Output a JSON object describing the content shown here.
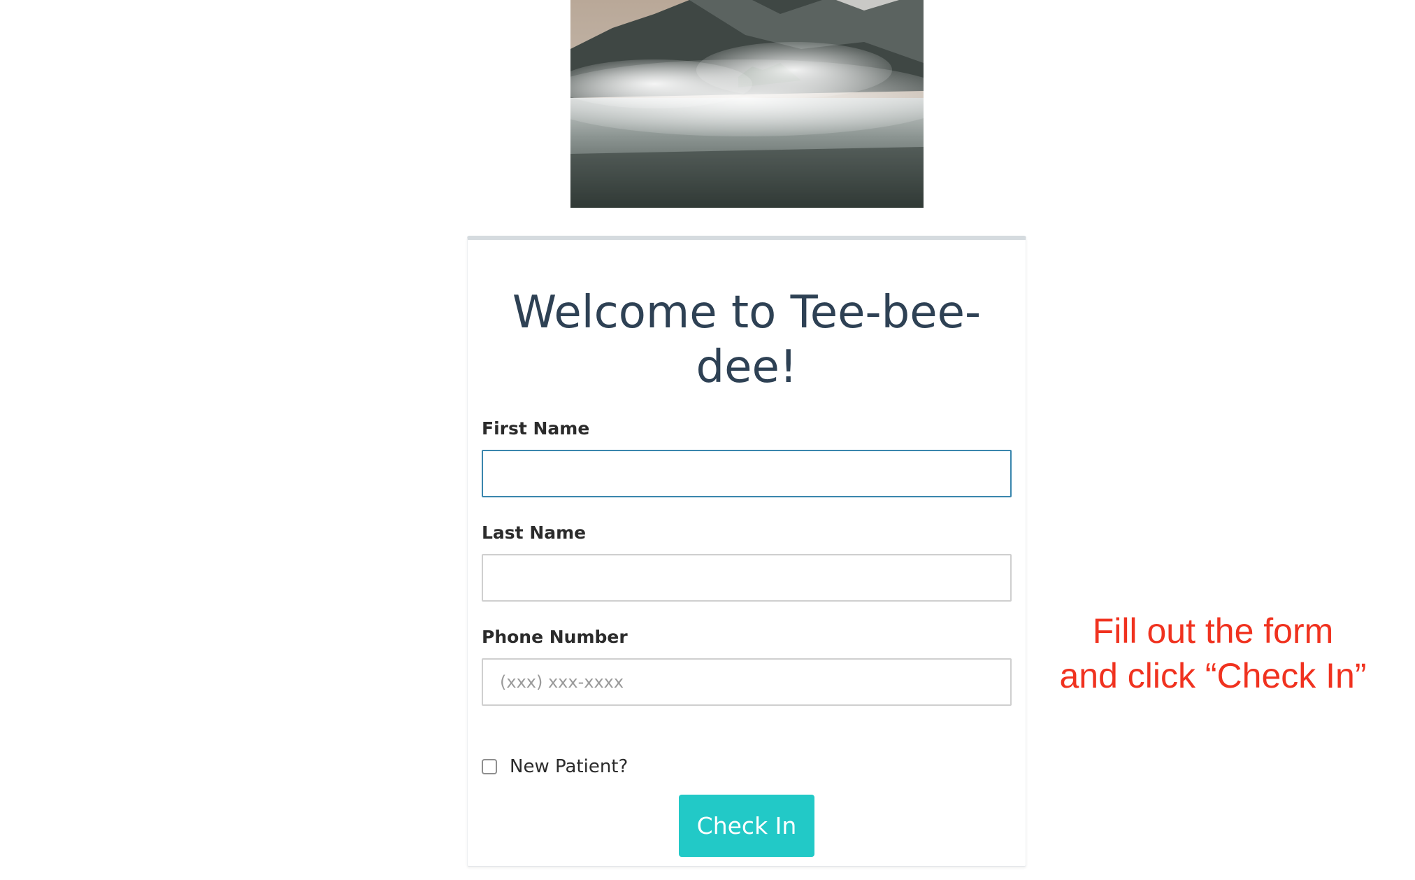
{
  "hero_image": {
    "description_icon": "misty-mountain-lake-photo"
  },
  "card": {
    "title_line1": "Welcome to Tee-bee-",
    "title_line2": "dee!",
    "fields": [
      {
        "label": "First Name",
        "value": "",
        "placeholder": ""
      },
      {
        "label": "Last Name",
        "value": "",
        "placeholder": ""
      },
      {
        "label": "Phone Number",
        "value": "",
        "placeholder": "(xxx) xxx-xxxx"
      }
    ],
    "new_patient": {
      "label": "New Patient?",
      "checked": false
    },
    "submit_label": "Check In"
  },
  "annotation": {
    "line1": "Fill out the form",
    "line2": "and click “Check In”"
  },
  "colors": {
    "accent_button": "#22c9c7",
    "title_text": "#2e4154",
    "focus_border": "#3a86ad",
    "annotation_text": "#f0321f"
  }
}
